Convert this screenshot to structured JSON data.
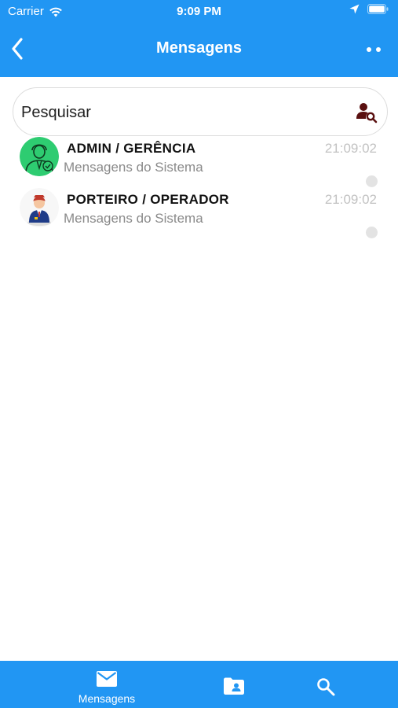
{
  "status_bar": {
    "carrier": "Carrier",
    "time": "9:09 PM"
  },
  "header": {
    "title": "Mensagens"
  },
  "search": {
    "placeholder": "Pesquisar"
  },
  "messages": [
    {
      "name": "ADMIN / GERÊNCIA",
      "subtitle": "Mensagens do Sistema",
      "time": "21:09:02",
      "avatar": "admin-avatar"
    },
    {
      "name": "PORTEIRO / OPERADOR",
      "subtitle": "Mensagens do Sistema",
      "time": "21:09:02",
      "avatar": "porter-avatar"
    }
  ],
  "tab_bar": {
    "tabs": [
      {
        "label": "Mensagens",
        "icon": "mail-icon"
      },
      {
        "label": "",
        "icon": "folder-contact-icon"
      },
      {
        "label": "",
        "icon": "search-icon"
      }
    ]
  },
  "colors": {
    "primary": "#2196F3",
    "admin_avatar_bg": "#2ECC71",
    "search_icon": "#5A1010",
    "muted_text": "#8A8A8A",
    "time_text": "#C2C2C2"
  }
}
